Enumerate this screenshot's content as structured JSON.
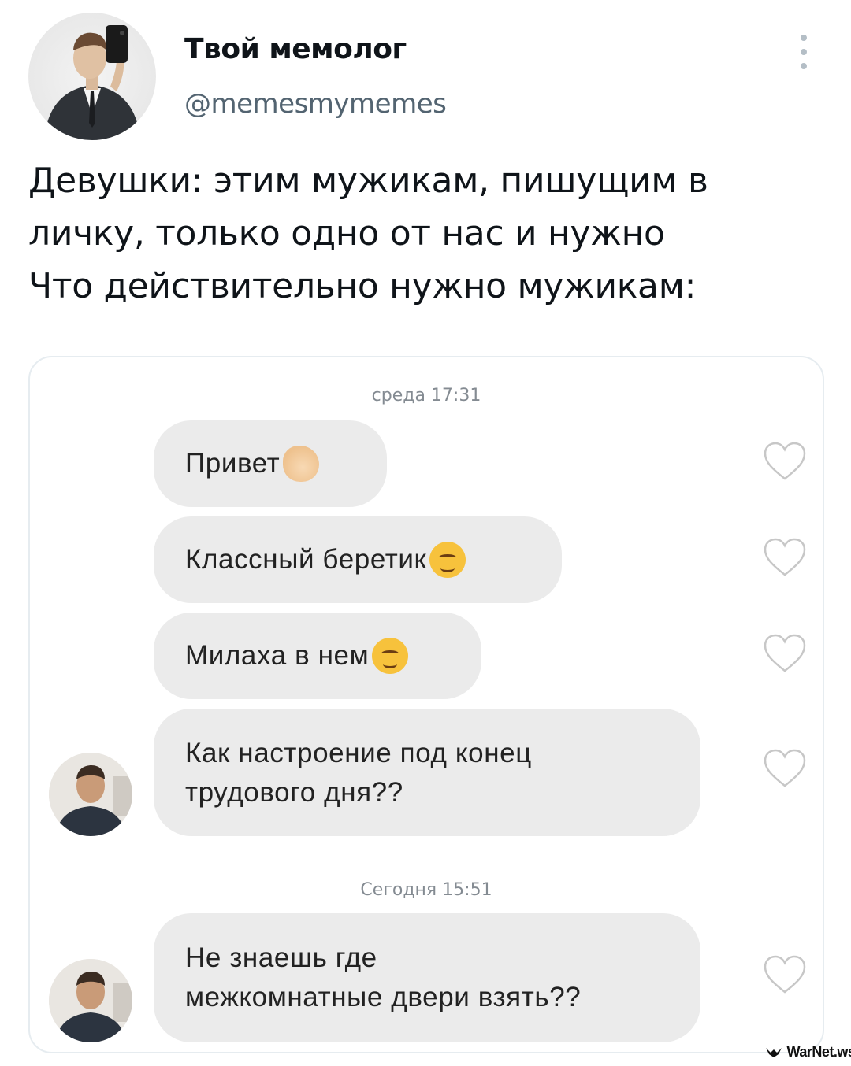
{
  "author": {
    "name": "Твой мемолог",
    "handle": "@memesmymemes"
  },
  "tweet": {
    "lines": [
      "Девушки: этим мужикам, пишущим в",
      "личку, только одно от нас и нужно",
      "Что действительно нужно мужикам:"
    ]
  },
  "chat": {
    "timestamp_1": "среда 17:31",
    "timestamp_2": "Сегодня 15:51",
    "messages": [
      {
        "lines": [
          "Привет"
        ],
        "emoji": "waving-hand-icon"
      },
      {
        "lines": [
          "Классный беретик"
        ],
        "emoji": "smirking-face-icon"
      },
      {
        "lines": [
          "Милаха в нем"
        ],
        "emoji": "hugging-face-icon"
      },
      {
        "lines": [
          "Как настроение под конец",
          "трудового дня??"
        ]
      },
      {
        "lines": [
          "Не знаешь где",
          "межкомнатные двери взять??"
        ]
      }
    ]
  },
  "watermark": "WarNet.ws",
  "colors": {
    "text": "#0f1419",
    "handle": "#536471",
    "bubble": "#ebebeb",
    "border": "#e6ecf0"
  }
}
